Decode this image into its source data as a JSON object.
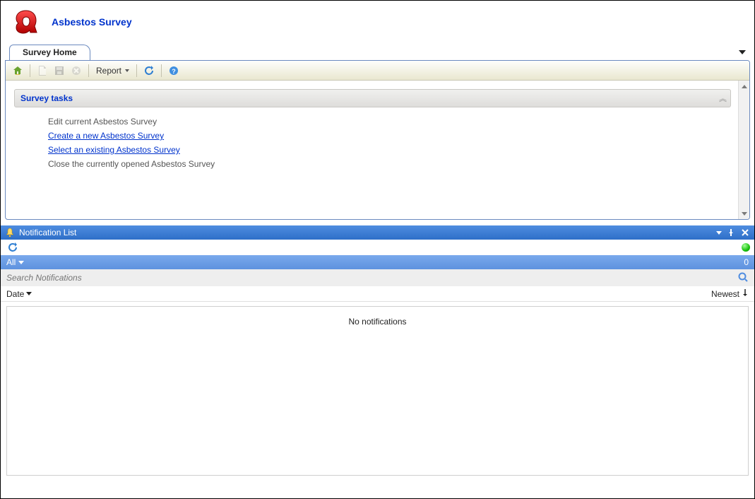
{
  "header": {
    "title": "Asbestos Survey"
  },
  "tabs": {
    "active": "Survey Home"
  },
  "toolbar": {
    "report_label": "Report"
  },
  "tasks": {
    "group_title": "Survey tasks",
    "items": [
      {
        "label": "Edit current Asbestos Survey",
        "enabled": false
      },
      {
        "label": "Create a new Asbestos Survey",
        "enabled": true
      },
      {
        "label": "Select an existing Asbestos Survey",
        "enabled": true
      },
      {
        "label": "Close the currently opened Asbestos Survey",
        "enabled": false
      }
    ]
  },
  "notifications": {
    "panel_title": "Notification List",
    "filter_label": "All",
    "filter_count": "0",
    "search_placeholder": "Search Notifications",
    "sort_left": "Date",
    "sort_right": "Newest",
    "empty_message": "No notifications"
  }
}
